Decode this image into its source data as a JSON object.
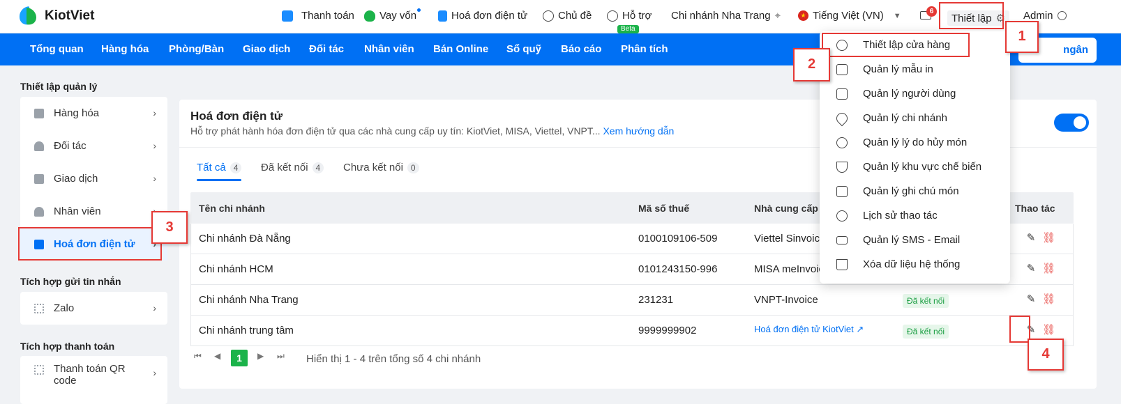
{
  "brand": {
    "name": "KiotViet"
  },
  "topbar": {
    "items": [
      {
        "label": "Thanh toán",
        "icon": "payment-icon"
      },
      {
        "label": "Vay vốn",
        "icon": "money-bag-icon"
      },
      {
        "label": "Hoá đơn điện tử",
        "icon": "invoice-icon"
      },
      {
        "label": "Chủ đề",
        "icon": "palette-icon"
      },
      {
        "label": "Hỗ trợ",
        "icon": "chat-icon",
        "badge": "Beta"
      }
    ],
    "branch": "Chi nhánh Nha Trang",
    "language": "Tiếng Việt (VN)",
    "mail_badge": "6",
    "settings_label": "Thiết lập",
    "user": "Admin"
  },
  "nav": {
    "items": [
      "Tổng quan",
      "Hàng hóa",
      "Phòng/Bàn",
      "Giao dịch",
      "Đối tác",
      "Nhân viên",
      "Bán Online",
      "Sổ quỹ",
      "Báo cáo",
      "Phân tích"
    ],
    "right_button": "ngân"
  },
  "sidebar": {
    "section1": "Thiết lập quản lý",
    "items1": [
      "Hàng hóa",
      "Đối tác",
      "Giao dịch",
      "Nhân viên",
      "Hoá đơn điện tử"
    ],
    "section2": "Tích hợp gửi tin nhắn",
    "items2": [
      "Zalo"
    ],
    "section3": "Tích hợp thanh toán",
    "items3": [
      "Thanh toán QR code"
    ]
  },
  "panel": {
    "title": "Hoá đơn điện tử",
    "subtitle": "Hỗ trợ phát hành hóa đơn điện tử qua các nhà cung cấp uy tín: KiotViet, MISA, Viettel, VNPT...",
    "guide_link": "Xem hướng dẫn",
    "enabled": true,
    "tabs": [
      {
        "label": "Tất cả",
        "count": "4"
      },
      {
        "label": "Đã kết nối",
        "count": "4"
      },
      {
        "label": "Chưa kết nối",
        "count": "0"
      }
    ],
    "columns": [
      "Tên chi nhánh",
      "Mã số thuế",
      "Nhà cung cấp",
      "Thao tác"
    ],
    "rows": [
      {
        "branch": "Chi nhánh Đà Nẵng",
        "tax": "0100109106-509",
        "provider": "Viettel Sinvoice",
        "status": ""
      },
      {
        "branch": "Chi nhánh HCM",
        "tax": "0101243150-996",
        "provider": "MISA meInvoice",
        "status": ""
      },
      {
        "branch": "Chi nhánh Nha Trang",
        "tax": "231231",
        "provider": "VNPT-Invoice",
        "status": "Đã kết nối"
      },
      {
        "branch": "Chi nhánh trung tâm",
        "tax": "9999999902",
        "provider": "Hoá đơn điện tử KiotViet",
        "status": "Đã kết nối"
      }
    ],
    "pager": {
      "current": "1",
      "info": "Hiển thị 1 - 4 trên tổng số 4 chi nhánh"
    }
  },
  "dropdown": {
    "items": [
      {
        "label": "Thiết lập cửa hàng",
        "icon": "wrench-icon"
      },
      {
        "label": "Quản lý mẫu in",
        "icon": "printer-icon"
      },
      {
        "label": "Quản lý người dùng",
        "icon": "user-file-icon"
      },
      {
        "label": "Quản lý chi nhánh",
        "icon": "location-icon"
      },
      {
        "label": "Quản lý lý do hủy món",
        "icon": "user-gear-icon"
      },
      {
        "label": "Quản lý khu vực chế biến",
        "icon": "mortar-icon"
      },
      {
        "label": "Quản lý ghi chú món",
        "icon": "note-icon"
      },
      {
        "label": "Lịch sử thao tác",
        "icon": "history-icon"
      },
      {
        "label": "Quản lý SMS - Email",
        "icon": "mail-icon"
      },
      {
        "label": "Xóa dữ liệu hệ thống",
        "icon": "trash-icon"
      }
    ]
  },
  "annotations": [
    "1",
    "2",
    "3",
    "4"
  ],
  "colors": {
    "primary": "#0070f4",
    "success": "#1bb34a",
    "annotation": "#e53935"
  }
}
